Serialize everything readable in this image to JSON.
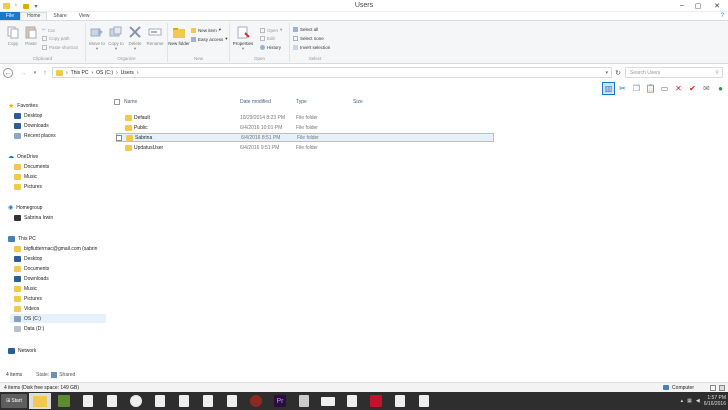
{
  "window": {
    "title": "Users"
  },
  "tabs": [
    {
      "label": "File"
    },
    {
      "label": "Home"
    },
    {
      "label": "Share"
    },
    {
      "label": "View"
    }
  ],
  "ribbon": {
    "clipboard": {
      "label": "Clipboard",
      "copy": "Copy",
      "paste": "Paste",
      "cut": "Cut",
      "copy_path": "Copy path",
      "paste_shortcut": "Paste shortcut"
    },
    "organize": {
      "label": "Organize",
      "move_to": "Move to",
      "copy_to": "Copy to",
      "delete": "Delete",
      "rename": "Rename"
    },
    "new": {
      "label": "New",
      "new_folder": "New folder",
      "new_item": "New item",
      "easy_access": "Easy access"
    },
    "open": {
      "label": "Open",
      "properties": "Properties",
      "open": "Open",
      "edit": "Edit",
      "history": "History"
    },
    "select": {
      "label": "Select",
      "select_all": "Select all",
      "select_none": "Select none",
      "invert_selection": "Invert selection"
    }
  },
  "address": {
    "crumbs": [
      "This PC",
      "OS (C:)",
      "Users"
    ],
    "search_placeholder": "Search Users"
  },
  "nav": {
    "favorites": "Favorites",
    "favorites_items": [
      "Desktop",
      "Downloads",
      "Recent places"
    ],
    "onedrive": "OneDrive",
    "onedrive_items": [
      "Documents",
      "Music",
      "Pictures"
    ],
    "homegroup": "Homegroup",
    "homegroup_items": [
      "Sabrina Irwin"
    ],
    "thispc": "This PC",
    "thispc_items": [
      "bigflutterrnac@gmail.com (sabrin",
      "Desktop",
      "Documents",
      "Downloads",
      "Music",
      "Pictures",
      "Videos",
      "OS (C:)",
      "Data (D:)"
    ],
    "network": "Network"
  },
  "columns": {
    "name": "Name",
    "date": "Date modified",
    "type": "Type",
    "size": "Size"
  },
  "files": [
    {
      "name": "Default",
      "date": "10/29/2014 8:23 PM",
      "type": "File folder"
    },
    {
      "name": "Public",
      "date": "6/4/2016 10:01 PM",
      "type": "File folder"
    },
    {
      "name": "Sabrina",
      "date": "6/4/2016 8:51 PM",
      "type": "File folder"
    },
    {
      "name": "UpdatusUser",
      "date": "6/4/2016 9:51 PM",
      "type": "File folder"
    }
  ],
  "status": {
    "items": "4 items",
    "state_label": "State:",
    "state_value": "Shared",
    "detail": "4 items (Disk free space: 149 GB)",
    "computer": "Computer"
  },
  "taskbar": {
    "start": "Start",
    "time": "1:57 PM",
    "date": "6/16/2016"
  },
  "colors": {
    "accent": "#1979ca",
    "folder": "#f2c94c",
    "selection": "#e5f1fb"
  }
}
